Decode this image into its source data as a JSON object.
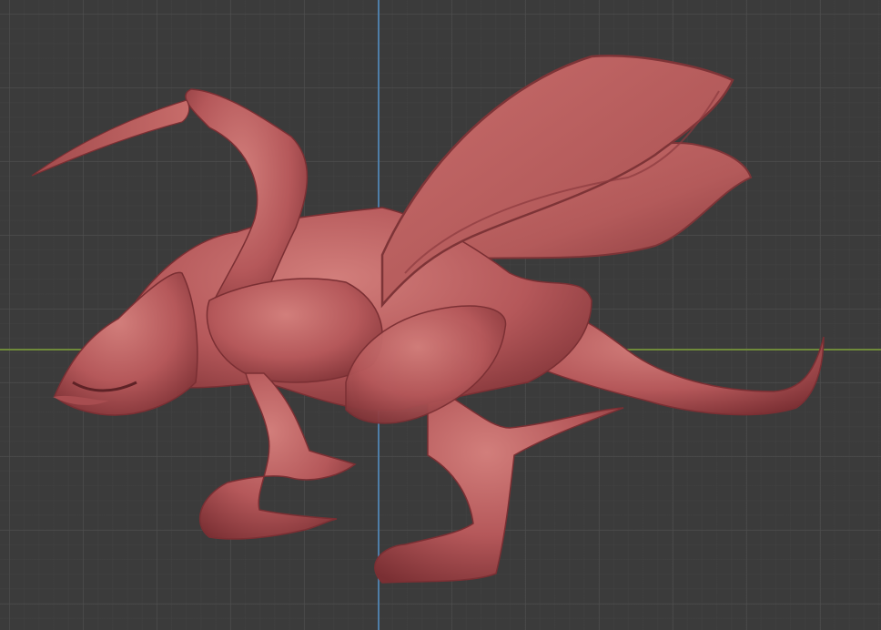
{
  "viewport": {
    "background_color": "#3b3b3b",
    "grid_color": "#505050",
    "x_axis_color": "#6f8a3a",
    "y_axis_color": "#4f7ea8"
  },
  "model": {
    "material_color": "#b5585a",
    "highlight_color": "#cf7a78",
    "shadow_color": "#7a2f33"
  }
}
